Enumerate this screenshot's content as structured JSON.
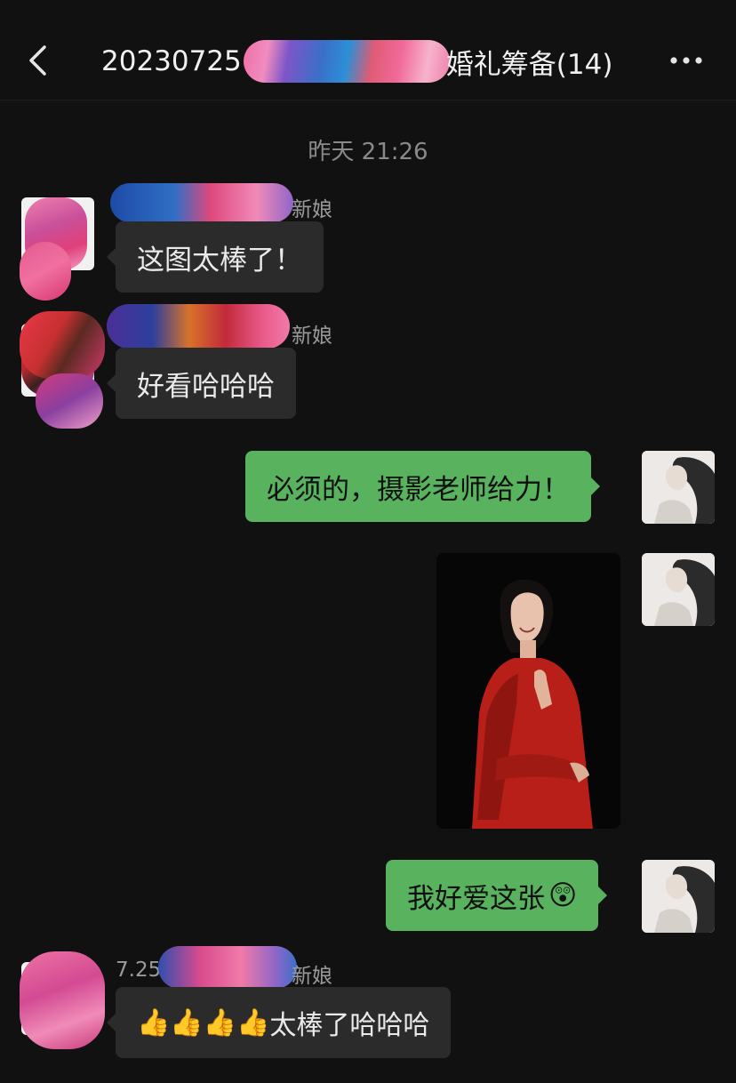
{
  "header": {
    "title_prefix": "20230725",
    "title_suffix": "婚礼筹备(14)",
    "back_icon": "chevron-left-icon",
    "more_icon": "more-dots-icon"
  },
  "chat": {
    "timestamp": "昨天 21:26",
    "messages": [
      {
        "side": "left",
        "sender_suffix": "新娘",
        "text": "这图太棒了！"
      },
      {
        "side": "left",
        "sender_suffix": "新娘",
        "text": "好看哈哈哈"
      },
      {
        "side": "right",
        "text": "必须的，摄影老师给力！"
      },
      {
        "side": "right",
        "type": "image",
        "content": "photo-woman-red-dress"
      },
      {
        "side": "right",
        "text": "我好爱这张",
        "emoji": "😲"
      },
      {
        "side": "left",
        "sender_prefix": "7.25",
        "sender_suffix": "新娘",
        "thumbs": "👍👍👍👍",
        "text": "太棒了哈哈哈"
      }
    ]
  },
  "colors": {
    "background": "#111111",
    "bubble_received": "#2b2b2b",
    "bubble_sent": "#58b25e"
  }
}
